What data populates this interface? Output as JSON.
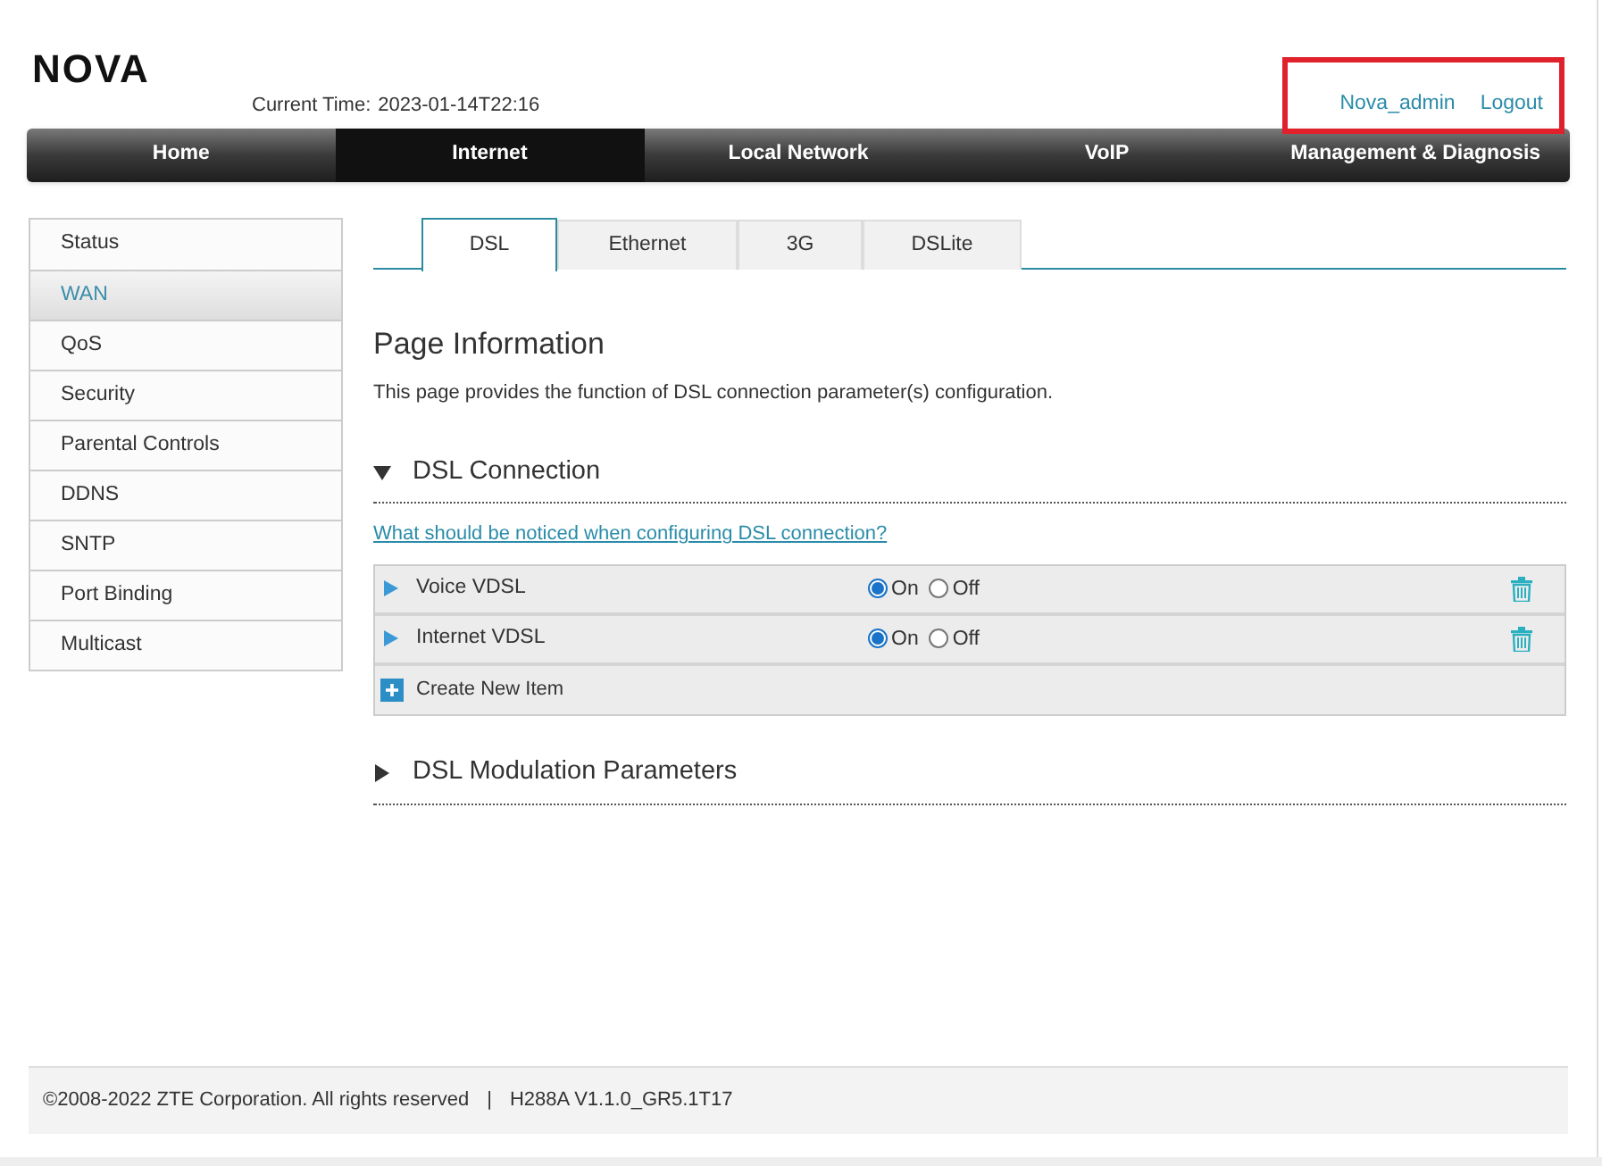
{
  "header": {
    "logo": "NOVA",
    "current_time_label": "Current Time:",
    "current_time": "2023-01-14T22:16",
    "user": "Nova_admin",
    "logout": "Logout",
    "highlighted": true
  },
  "nav": [
    {
      "label": "Home",
      "selected": false
    },
    {
      "label": "Internet",
      "selected": true
    },
    {
      "label": "Local Network",
      "selected": false
    },
    {
      "label": "VoIP",
      "selected": false
    },
    {
      "label": "Management & Diagnosis",
      "selected": false
    }
  ],
  "sidebar": {
    "items": [
      {
        "label": "Status",
        "selected": false
      },
      {
        "label": "WAN",
        "selected": true
      },
      {
        "label": "QoS",
        "selected": false
      },
      {
        "label": "Security",
        "selected": false
      },
      {
        "label": "Parental Controls",
        "selected": false
      },
      {
        "label": "DDNS",
        "selected": false
      },
      {
        "label": "SNTP",
        "selected": false
      },
      {
        "label": "Port Binding",
        "selected": false
      },
      {
        "label": "Multicast",
        "selected": false
      }
    ]
  },
  "tabs": [
    {
      "label": "DSL",
      "selected": true
    },
    {
      "label": "Ethernet",
      "selected": false
    },
    {
      "label": "3G",
      "selected": false
    },
    {
      "label": "DSLite",
      "selected": false
    }
  ],
  "page_info": {
    "title": "Page Information",
    "description": "This page provides the function of DSL connection parameter(s) configuration."
  },
  "sections": [
    {
      "title": "DSL Connection",
      "expanded": true,
      "help_link": "What should be noticed when configuring DSL connection?",
      "items": [
        {
          "name": "Voice VDSL",
          "options": [
            {
              "label": "On",
              "selected": true
            },
            {
              "label": "Off",
              "selected": false
            }
          ]
        },
        {
          "name": "Internet VDSL",
          "options": [
            {
              "label": "On",
              "selected": true
            },
            {
              "label": "Off",
              "selected": false
            }
          ]
        }
      ],
      "create_label": "Create New Item"
    },
    {
      "title": "DSL Modulation Parameters",
      "expanded": false
    }
  ],
  "footer": {
    "copyright": "©2008-2022 ZTE Corporation. All rights reserved",
    "separator": "|",
    "version": "H288A V1.1.0_GR5.1T17"
  }
}
